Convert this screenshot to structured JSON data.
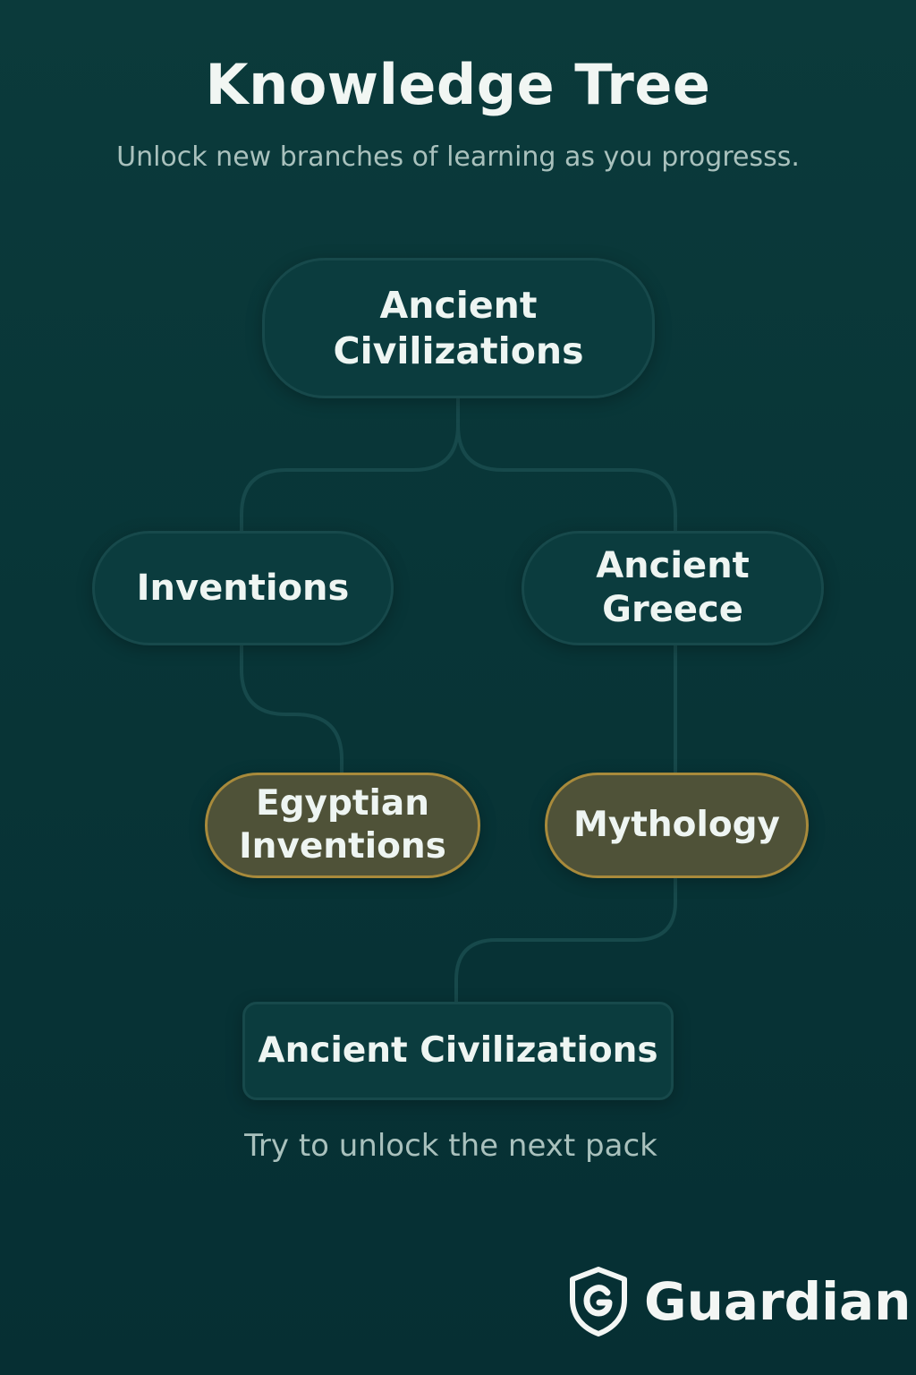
{
  "header": {
    "title": "Knowledge Tree",
    "subtitle": "Unlock new branches of learning as you progresss."
  },
  "tree": {
    "root": {
      "label": "Ancient\nCivilizations",
      "state": "unlocked"
    },
    "left_branch": {
      "label": "Inventions",
      "state": "unlocked"
    },
    "right_branch": {
      "label": "Ancient\nGreece",
      "state": "unlocked"
    },
    "left_leaf": {
      "label": "Egyptian\nInventions",
      "state": "highlighted"
    },
    "right_leaf": {
      "label": "Mythology",
      "state": "highlighted"
    }
  },
  "next_pack": {
    "label": "Ancient Civilizations",
    "hint": "Try to unlock the next pack"
  },
  "brand": {
    "name": "Guardian",
    "icon": "shield-g-icon"
  },
  "colors": {
    "background": "#083537",
    "node_fill": "#0b3c3e",
    "node_border": "#17494b",
    "highlight_fill": "#4f5238",
    "highlight_border": "#a88a3b",
    "text": "#eef5f2",
    "muted_text": "#a9c1bd"
  }
}
